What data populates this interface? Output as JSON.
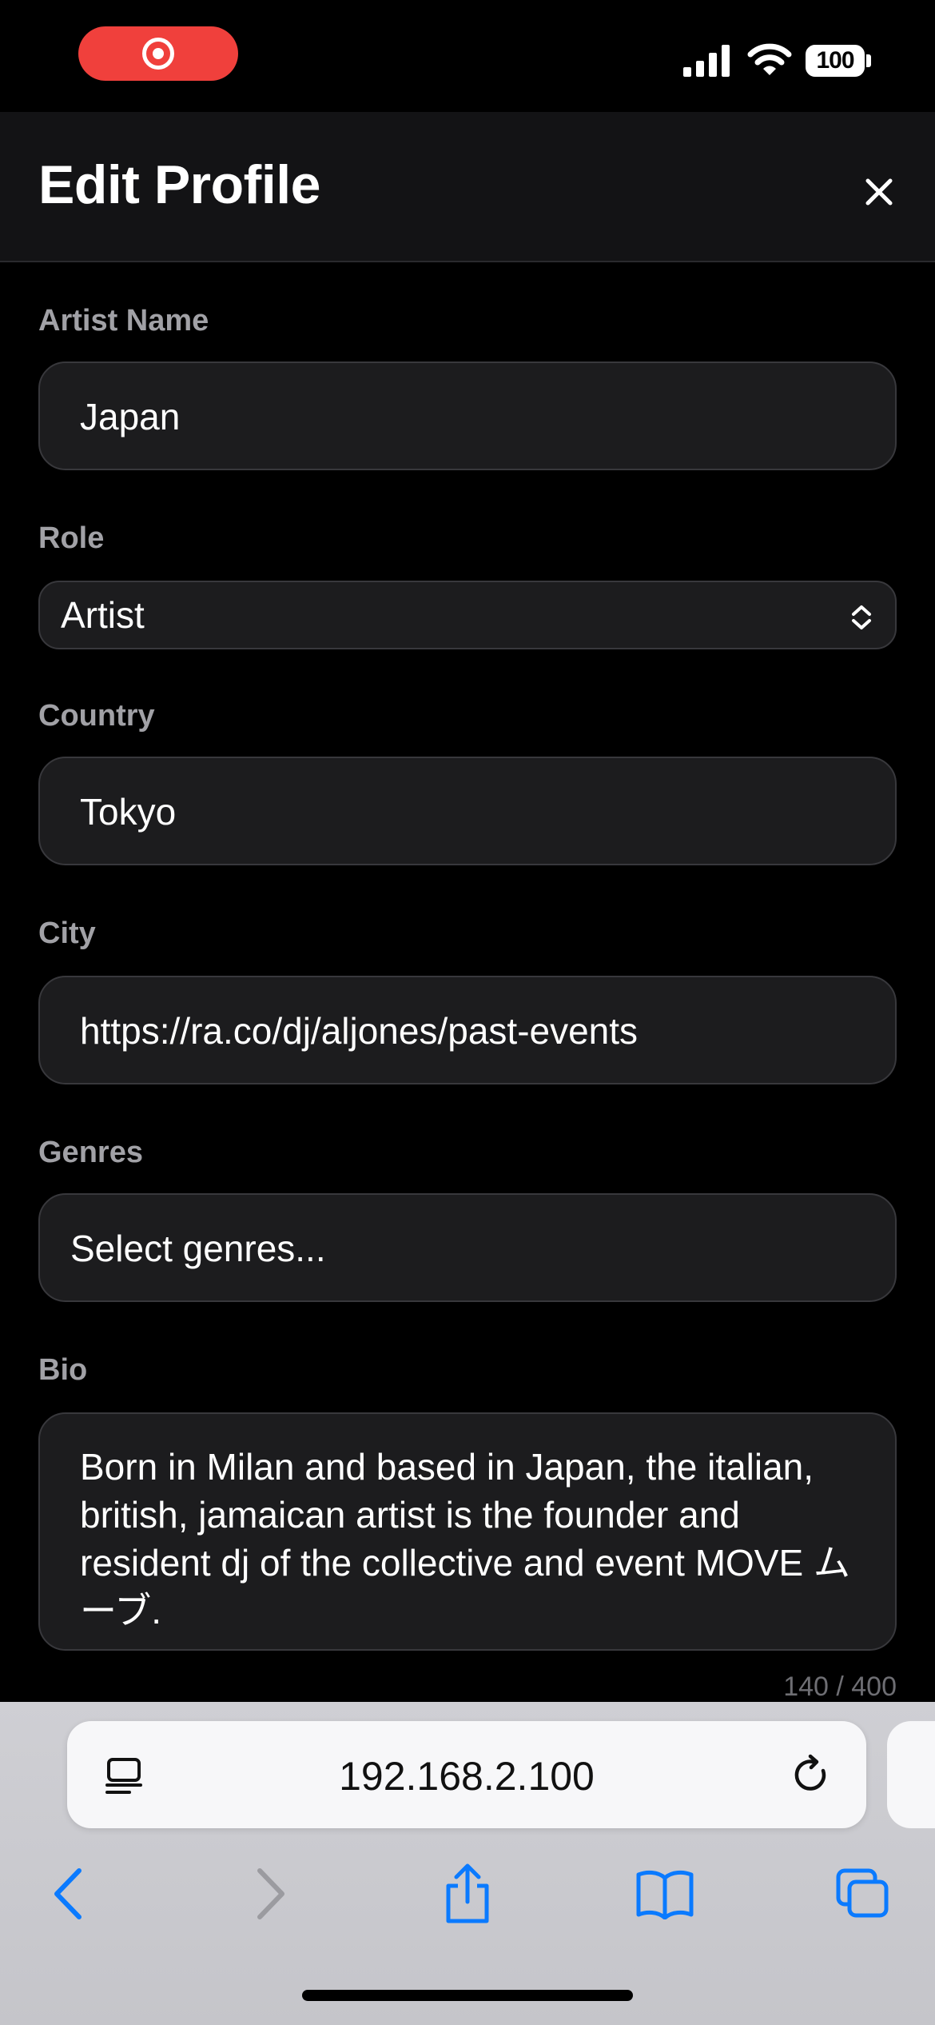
{
  "status_bar": {
    "battery": "100"
  },
  "header": {
    "title": "Edit Profile"
  },
  "form": {
    "artist_name": {
      "label": "Artist Name",
      "value": "Japan"
    },
    "role": {
      "label": "Role",
      "value": "Artist"
    },
    "country": {
      "label": "Country",
      "value": "Tokyo"
    },
    "city": {
      "label": "City",
      "value": "https://ra.co/dj/aljones/past-events"
    },
    "genres": {
      "label": "Genres",
      "placeholder": "Select genres..."
    },
    "bio": {
      "label": "Bio",
      "value": "Born in Milan and based in Japan, the italian, british, jamaican artist is the founder and resident dj of the collective and event MOVE ムーブ.",
      "char_count": "140 / 400"
    }
  },
  "browser": {
    "url": "192.168.2.100"
  },
  "colors": {
    "accent": "#0a7aff",
    "record": "#f0403c"
  }
}
